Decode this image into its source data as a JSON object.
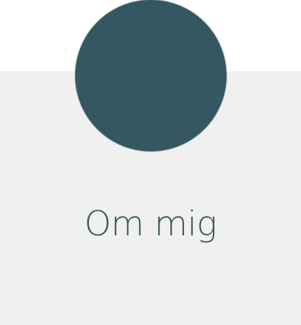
{
  "section": {
    "title": "Om mig"
  },
  "colors": {
    "circle": "#355762",
    "panel_background": "#f0f0ef",
    "title_text": "#3a5863",
    "page_background": "#ffffff"
  }
}
